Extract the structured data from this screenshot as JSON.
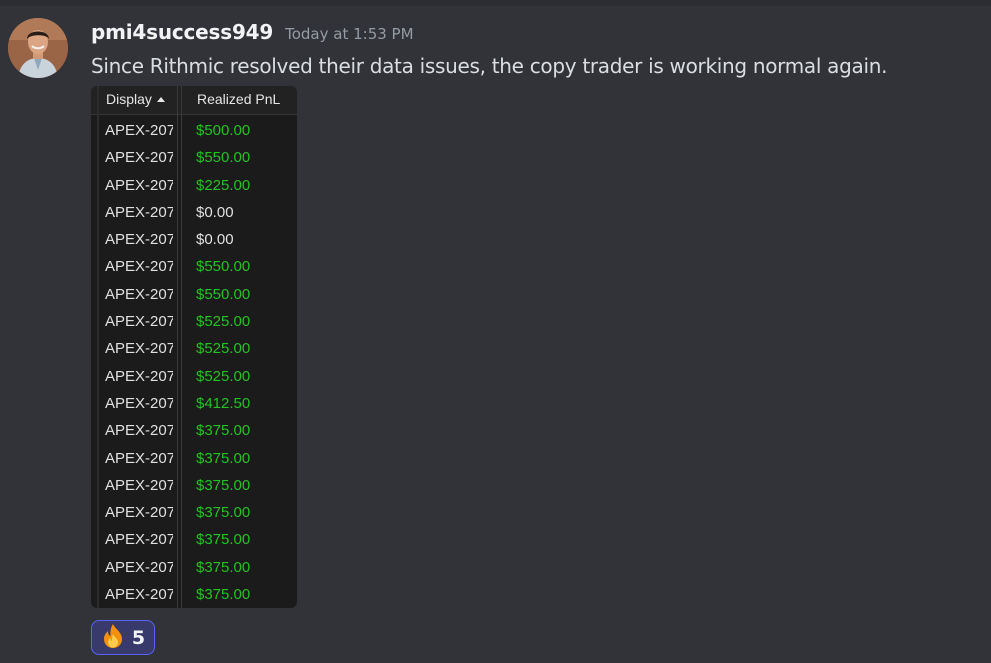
{
  "message": {
    "username": "pmi4success949",
    "timestamp": "Today at 1:53 PM",
    "text": "Since Rithmic resolved their data issues, the copy trader is working normal again.",
    "avatar_icon": "user-avatar"
  },
  "attachment": {
    "columns": {
      "display": "Display",
      "realized_pnl": "Realized PnL"
    },
    "sort_icon": "sort-ascending-icon",
    "rows": [
      {
        "display": "APEX-207",
        "pnl": "$500.00",
        "status": "positive"
      },
      {
        "display": "APEX-207",
        "pnl": "$550.00",
        "status": "positive"
      },
      {
        "display": "APEX-207",
        "pnl": "$225.00",
        "status": "positive"
      },
      {
        "display": "APEX-207",
        "pnl": "$0.00",
        "status": "zero"
      },
      {
        "display": "APEX-207",
        "pnl": "$0.00",
        "status": "zero"
      },
      {
        "display": "APEX-207",
        "pnl": "$550.00",
        "status": "positive"
      },
      {
        "display": "APEX-207",
        "pnl": "$550.00",
        "status": "positive"
      },
      {
        "display": "APEX-207",
        "pnl": "$525.00",
        "status": "positive"
      },
      {
        "display": "APEX-207",
        "pnl": "$525.00",
        "status": "positive"
      },
      {
        "display": "APEX-207",
        "pnl": "$525.00",
        "status": "positive"
      },
      {
        "display": "APEX-207",
        "pnl": "$412.50",
        "status": "positive"
      },
      {
        "display": "APEX-207",
        "pnl": "$375.00",
        "status": "positive"
      },
      {
        "display": "APEX-207",
        "pnl": "$375.00",
        "status": "positive"
      },
      {
        "display": "APEX-207",
        "pnl": "$375.00",
        "status": "positive"
      },
      {
        "display": "APEX-207",
        "pnl": "$375.00",
        "status": "positive"
      },
      {
        "display": "APEX-207",
        "pnl": "$375.00",
        "status": "positive"
      },
      {
        "display": "APEX-207",
        "pnl": "$375.00",
        "status": "positive"
      },
      {
        "display": "APEX-207",
        "pnl": "$375.00",
        "status": "positive"
      }
    ]
  },
  "reaction": {
    "emoji_icon": "fire-emoji-icon",
    "count": "5"
  },
  "colors": {
    "background": "#313338",
    "positive": "#22c322",
    "accent": "#5865f2"
  }
}
